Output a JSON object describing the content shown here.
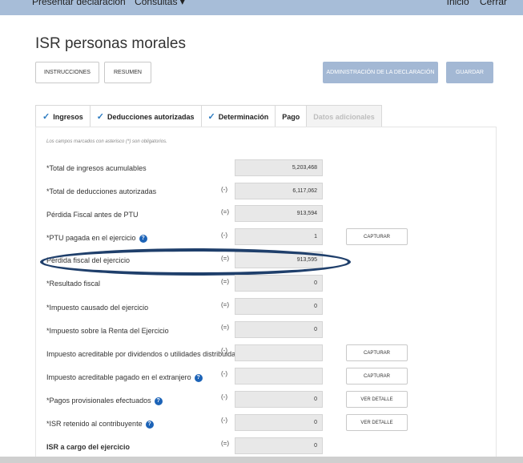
{
  "topnav": {
    "left": [
      "Presentar declaración",
      "Consultas ▾"
    ],
    "right": [
      "Inicio",
      "Cerrar"
    ]
  },
  "page": {
    "title": "ISR personas morales"
  },
  "buttons": {
    "instrucciones": "INSTRUCCIONES",
    "resumen": "RESUMEN",
    "administracion": "ADMINISTRACIÓN DE LA DECLARACIÓN",
    "guardar": "GUARDAR"
  },
  "tabs": [
    {
      "label": "Ingresos",
      "checked": true
    },
    {
      "label": "Deducciones autorizadas",
      "checked": true
    },
    {
      "label": "Determinación",
      "checked": true
    },
    {
      "label": "Pago",
      "checked": false
    },
    {
      "label": "Datos adicionales",
      "checked": false
    }
  ],
  "form": {
    "note": "Los campos marcados con asterisco (*) son obligatorios.",
    "rows": [
      {
        "label": "*Total de ingresos acumulables",
        "op": "",
        "value": "5,203,468",
        "button": ""
      },
      {
        "label": "*Total de deducciones autorizadas",
        "op": "(-)",
        "value": "6,117,062",
        "button": ""
      },
      {
        "label": "Pérdida Fiscal antes de PTU",
        "op": "(=)",
        "value": "913,594",
        "button": ""
      },
      {
        "label": "*PTU pagada en el ejercicio",
        "op": "(-)",
        "value": "1",
        "button": "CAPTURAR"
      },
      {
        "label": "Pérdida fiscal del ejercicio",
        "op": "(=)",
        "value": "913,595",
        "button": ""
      },
      {
        "label": "*Resultado fiscal",
        "op": "(=)",
        "value": "0",
        "button": ""
      },
      {
        "label": "*Impuesto causado del ejercicio",
        "op": "(=)",
        "value": "0",
        "button": ""
      },
      {
        "label": "*Impuesto sobre la Renta del Ejercicio",
        "op": "(=)",
        "value": "0",
        "button": ""
      },
      {
        "label": "Impuesto acreditable por dividendos o utilidades distribuidas",
        "op": "(-)",
        "value": "",
        "button": "CAPTURAR"
      },
      {
        "label": "Impuesto acreditable pagado en el extranjero",
        "op": "(-)",
        "value": "",
        "button": "CAPTURAR"
      },
      {
        "label": "*Pagos provisionales efectuados",
        "op": "(-)",
        "value": "0",
        "button": "VER DETALLE"
      },
      {
        "label": "*ISR retenido al contribuyente",
        "op": "(-)",
        "value": "0",
        "button": "VER DETALLE"
      },
      {
        "label": "ISR a cargo del ejercicio",
        "op": "(=)",
        "value": "0",
        "button": ""
      }
    ]
  }
}
